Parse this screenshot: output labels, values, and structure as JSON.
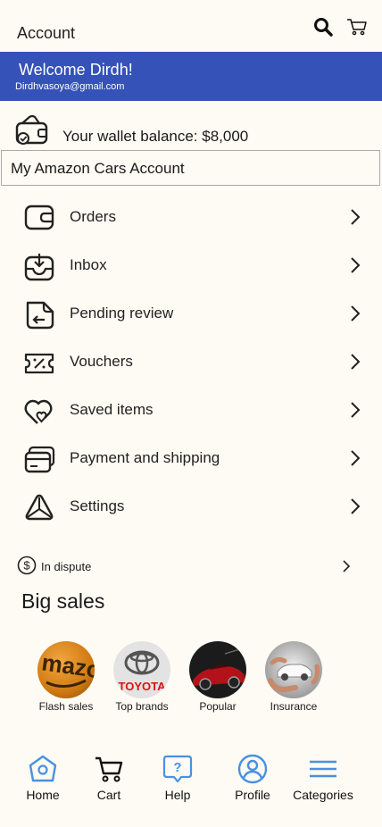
{
  "header": {
    "title": "Account"
  },
  "welcome": {
    "greeting": "Welcome Dirdh!",
    "email": "Dirdhvasoya@gmail.com"
  },
  "wallet": {
    "text": "Your wallet balance: $8,000"
  },
  "account_box": {
    "label": "My Amazon Cars Account"
  },
  "menu": [
    {
      "label": "Orders",
      "icon": "orders-icon"
    },
    {
      "label": "Inbox",
      "icon": "inbox-icon"
    },
    {
      "label": "Pending review",
      "icon": "pending-review-icon"
    },
    {
      "label": "Vouchers",
      "icon": "voucher-icon"
    },
    {
      "label": "Saved items",
      "icon": "saved-items-icon"
    },
    {
      "label": "Payment and shipping",
      "icon": "payment-card-icon"
    },
    {
      "label": "Settings",
      "icon": "settings-icon"
    }
  ],
  "dispute": {
    "label": "In dispute"
  },
  "big_sales": {
    "title": "Big sales",
    "items": [
      {
        "label": "Flash sales"
      },
      {
        "label": "Top brands",
        "brand_text": "TOYOTA"
      },
      {
        "label": "Popular"
      },
      {
        "label": "Insurance"
      }
    ]
  },
  "bottom_nav": [
    {
      "label": "Home"
    },
    {
      "label": "Cart"
    },
    {
      "label": "Help"
    },
    {
      "label": "Profile"
    },
    {
      "label": "Categories"
    }
  ],
  "colors": {
    "banner": "#3552b8",
    "accent": "#4a90e2",
    "background": "#fdfbf3"
  }
}
